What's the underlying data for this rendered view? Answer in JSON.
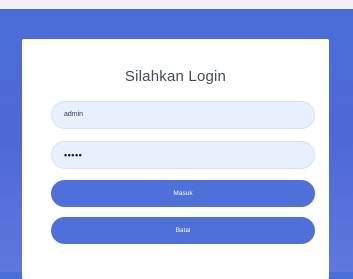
{
  "login": {
    "title": "Silahkan Login",
    "username_value": "admin",
    "password_value": "•••••",
    "submit_label": "Masuk",
    "cancel_label": "Batal"
  },
  "colors": {
    "background": "#4e68d6",
    "card": "#ffffff",
    "field_bg": "#e9f0fd",
    "button": "#4f6fd9",
    "title_text": "#444b55"
  }
}
